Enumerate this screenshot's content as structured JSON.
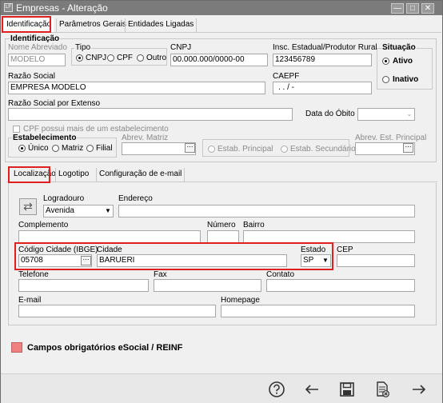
{
  "window": {
    "title": "Empresas - Alteração",
    "app_icon": "LF"
  },
  "top_tabs": [
    "Identificação",
    "Parâmetros Gerais",
    "Entidades Ligadas"
  ],
  "identificacao": {
    "section_label": "Identificação",
    "nome_abreviado_label": "Nome Abreviado",
    "nome_abreviado_value": "MODELO",
    "tipo_label": "Tipo",
    "tipo_options": [
      "CNPJ",
      "CPF",
      "Outro"
    ],
    "tipo_selected": "CNPJ",
    "cnpj_label": "CNPJ",
    "cnpj_value": "00.000.000/0000-00",
    "insc_label": "Insc. Estadual/Produtor Rural",
    "insc_value": "123456789",
    "situacao_label": "Situação",
    "situacao_options": [
      "Ativo",
      "Inativo"
    ],
    "situacao_selected": "Ativo",
    "razao_social_label": "Razão Social",
    "razao_social_value": "EMPRESA MODELO",
    "caepf_label": "CAEPF",
    "caepf_value": ". . /  -",
    "razao_extenso_label": "Razão Social por Extenso",
    "razao_extenso_value": "",
    "data_obito_label": "Data do Óbito",
    "cpf_multi_label": "CPF possui mais de um estabelecimento",
    "estabelecimento_label": "Estabelecimento",
    "estabelecimento_options": [
      "Único",
      "Matriz",
      "Filial"
    ],
    "estabelecimento_selected": "Único",
    "abrev_matriz_label": "Abrev. Matriz",
    "estab_principal_label": "Estab. Principal",
    "estab_secundario_label": "Estab. Secundário",
    "abrev_est_principal_label": "Abrev. Est. Principal"
  },
  "inner_tabs": [
    "Localização",
    "Logotipo",
    "Configuração de e-mail"
  ],
  "localizacao": {
    "logradouro_label": "Logradouro",
    "logradouro_value": "Avenida",
    "endereco_label": "Endereço",
    "complemento_label": "Complemento",
    "numero_label": "Número",
    "bairro_label": "Bairro",
    "cod_cidade_label": "Código Cidade (IBGE)",
    "cod_cidade_value": "05708",
    "cidade_label": "Cidade",
    "cidade_value": "BARUERI",
    "estado_label": "Estado",
    "estado_value": "SP",
    "cep_label": "CEP",
    "telefone_label": "Telefone",
    "fax_label": "Fax",
    "contato_label": "Contato",
    "email_label": "E-mail",
    "homepage_label": "Homepage"
  },
  "legend": {
    "text": "Campos obrigatórios eSocial / REINF",
    "color": "#f08080"
  },
  "colors": {
    "highlight": "#e02020",
    "titlebar": "#7b7b7b"
  },
  "toolbar_icons": [
    "help-icon",
    "back-arrow-icon",
    "save-icon",
    "cancel-document-icon",
    "exit-arrow-icon"
  ]
}
